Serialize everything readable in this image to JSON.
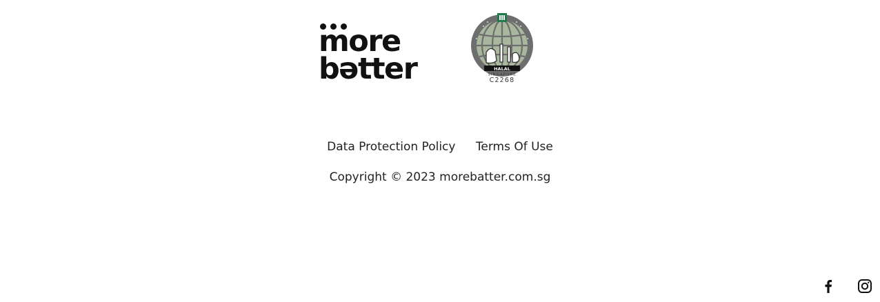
{
  "logos": {
    "brand": {
      "line1": "more",
      "line2": "bətter"
    },
    "halal": {
      "label": "HALAL",
      "country": "SINGAPORE",
      "cert_number": "C2268"
    }
  },
  "footer": {
    "links": {
      "data_protection": "Data Protection Policy",
      "terms": "Terms Of Use"
    },
    "copyright": "Copyright © 2023 morebatter.com.sg"
  },
  "social": {
    "icons": [
      "facebook-icon",
      "instagram-icon"
    ]
  },
  "colors": {
    "text": "#222222",
    "logo": "#111111",
    "halal_green": "#a9b79e",
    "halal_grey": "#6e6e6e",
    "halal_dark_green": "#1f7a4a"
  }
}
